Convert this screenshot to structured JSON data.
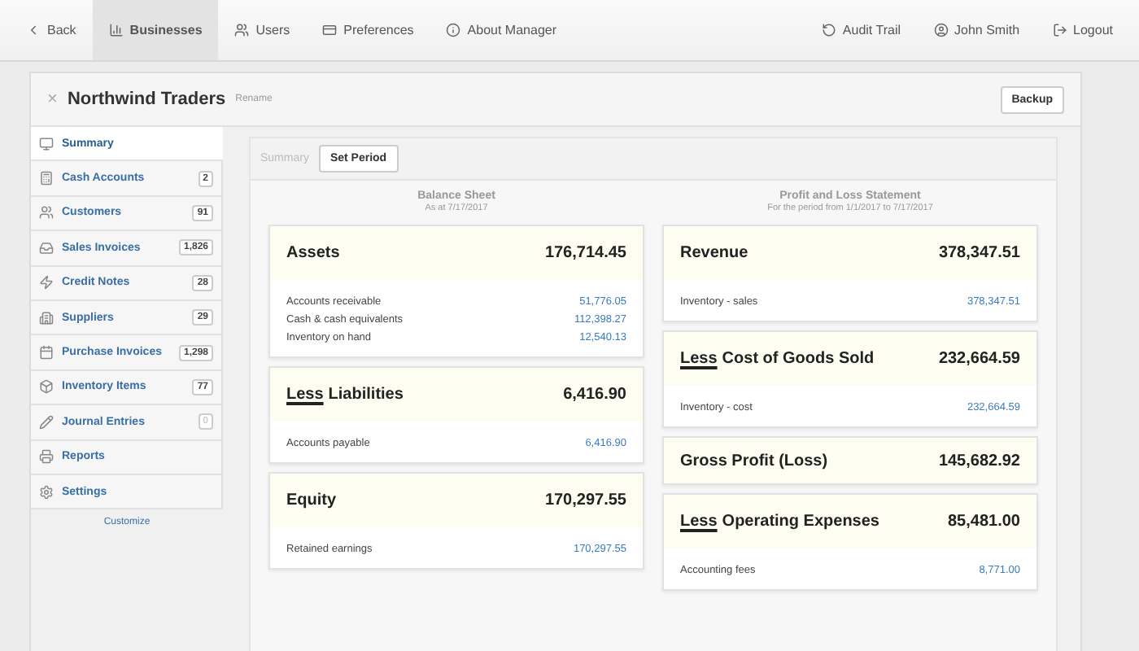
{
  "nav": {
    "left": [
      {
        "label": "Back",
        "selected": false
      },
      {
        "label": "Businesses",
        "selected": true
      },
      {
        "label": "Users",
        "selected": false
      },
      {
        "label": "Preferences",
        "selected": false
      },
      {
        "label": "About Manager",
        "selected": false
      }
    ],
    "right": [
      {
        "label": "Audit Trail"
      },
      {
        "label": "John Smith"
      },
      {
        "label": "Logout"
      }
    ]
  },
  "business": {
    "close": "×",
    "name": "Northwind Traders",
    "rename": "Rename",
    "backup": "Backup"
  },
  "sidebar": {
    "items": [
      {
        "label": "Summary",
        "selected": true
      },
      {
        "label": "Cash Accounts",
        "count": "2",
        "selected": false
      },
      {
        "label": "Customers",
        "count": "91",
        "selected": false
      },
      {
        "label": "Sales Invoices",
        "count": "1,826",
        "selected": false
      },
      {
        "label": "Credit Notes",
        "count": "28",
        "selected": false
      },
      {
        "label": "Suppliers",
        "count": "29",
        "selected": false
      },
      {
        "label": "Purchase Invoices",
        "count": "1,298",
        "selected": false
      },
      {
        "label": "Inventory Items",
        "count": "77",
        "selected": false
      },
      {
        "label": "Journal Entries",
        "count": "0",
        "selected": false
      },
      {
        "label": "Reports",
        "selected": false
      },
      {
        "label": "Settings",
        "selected": false
      }
    ],
    "customize": "Customize"
  },
  "content": {
    "title": "Summary",
    "set_period": "Set Period",
    "columns": [
      {
        "title": "Balance Sheet",
        "subtitle": "As at 7/17/2017",
        "cards": [
          {
            "title": "Assets",
            "total": "176,714.45",
            "rows": [
              {
                "label": "Accounts receivable",
                "value": "51,776.05"
              },
              {
                "label": "Cash & cash equivalents",
                "value": "112,398.27"
              },
              {
                "label": "Inventory on hand",
                "value": "12,540.13"
              }
            ]
          },
          {
            "prefix": "Less",
            "title": "Liabilities",
            "total": "6,416.90",
            "rows": [
              {
                "label": "Accounts payable",
                "value": "6,416.90"
              }
            ]
          },
          {
            "title": "Equity",
            "total": "170,297.55",
            "rows": [
              {
                "label": "Retained earnings",
                "value": "170,297.55"
              }
            ]
          }
        ]
      },
      {
        "title": "Profit and Loss Statement",
        "subtitle": "For the period from 1/1/2017 to 7/17/2017",
        "cards": [
          {
            "title": "Revenue",
            "total": "378,347.51",
            "rows": [
              {
                "label": "Inventory - sales",
                "value": "378,347.51"
              }
            ]
          },
          {
            "prefix": "Less",
            "title": "Cost of Goods Sold",
            "total": "232,664.59",
            "rows": [
              {
                "label": "Inventory - cost",
                "value": "232,664.59"
              }
            ]
          },
          {
            "title": "Gross Profit (Loss)",
            "total": "145,682.92"
          },
          {
            "prefix": "Less",
            "title": "Operating Expenses",
            "total": "85,481.00",
            "rows": [
              {
                "label": "Accounting fees",
                "value": "8,771.00"
              }
            ]
          }
        ]
      }
    ]
  }
}
